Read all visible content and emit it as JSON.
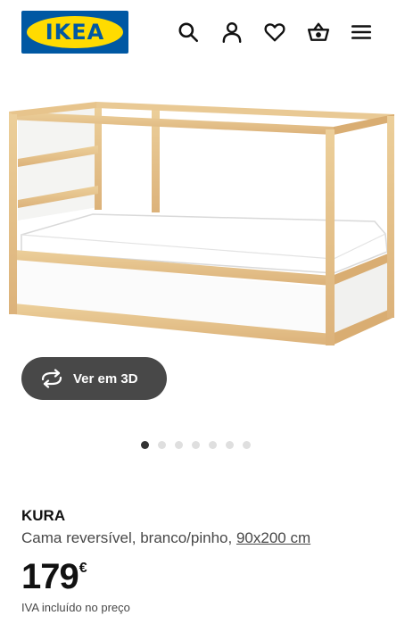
{
  "header": {
    "logo_text": "IKEA",
    "icons": [
      "search-icon",
      "profile-icon",
      "heart-icon",
      "basket-icon",
      "menu-icon"
    ]
  },
  "gallery": {
    "view3d_label": "Ver em 3D",
    "slide_count": 7,
    "active_slide": 1
  },
  "product": {
    "name": "KURA",
    "description": "Cama reversível, branco/pinho,",
    "size": "90x200 cm",
    "price_integer": "179",
    "currency": "€",
    "vat_note": "IVA incluído no preço"
  },
  "colors": {
    "ikea_blue": "#0058a3",
    "ikea_yellow": "#ffdb00",
    "dark_button": "#484848",
    "pine": "#e3bf86"
  }
}
